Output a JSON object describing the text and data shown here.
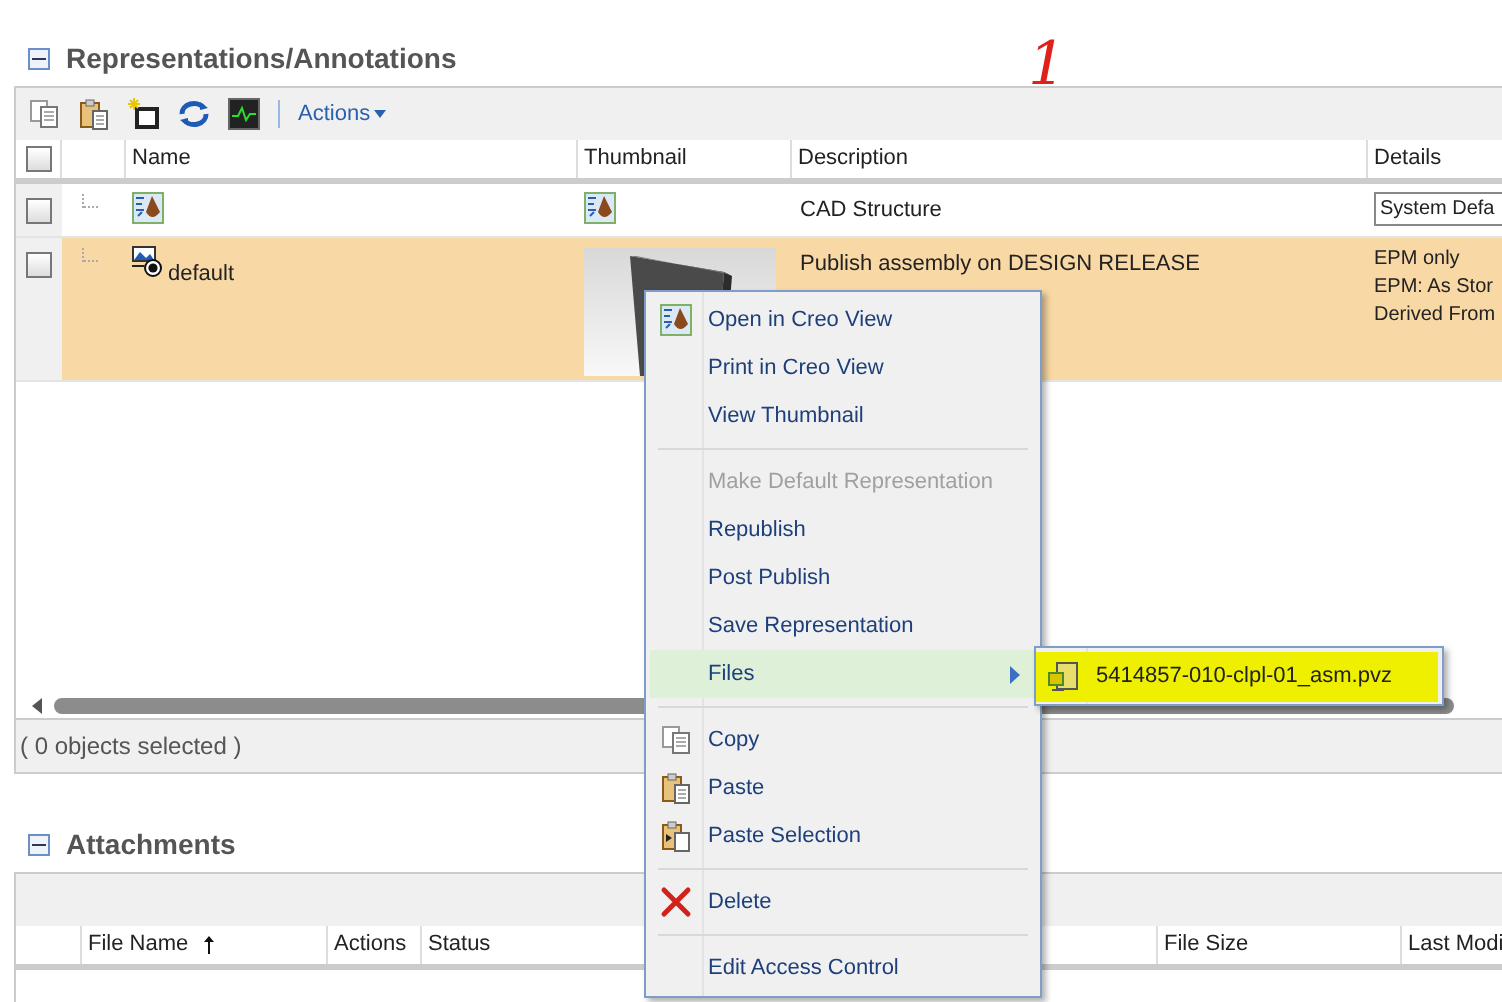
{
  "annotation_mark": "1",
  "representations": {
    "title": "Representations/Annotations",
    "expanded": true,
    "actions_label": "Actions",
    "all_checked": false,
    "columns": [
      "Name",
      "Thumbnail",
      "Description",
      "Details"
    ],
    "rows": [
      {
        "kind": "structure",
        "selected": false,
        "checked": false,
        "description": "CAD Structure",
        "details": [
          "System Defa"
        ]
      },
      {
        "kind": "representation",
        "selected": true,
        "checked": false,
        "name": "default",
        "description": "Publish assembly on DESIGN RELEASE",
        "details": [
          "EPM only",
          "EPM: As Stor",
          "Derived From"
        ]
      }
    ],
    "status": "( 0 objects selected )"
  },
  "attachments": {
    "title": "Attachments",
    "expanded": true,
    "columns": [
      {
        "label": "File Name",
        "sorted": true
      },
      {
        "label": "Actions"
      },
      {
        "label": "Status"
      },
      {
        "label": "File Size"
      },
      {
        "label": "Last Modi"
      }
    ]
  },
  "context_menu": {
    "items": [
      {
        "kind": "item",
        "label": "Open in Creo View",
        "disabled": false,
        "highlighted": false,
        "submenu": false
      },
      {
        "kind": "item",
        "label": "Print in Creo View",
        "disabled": false,
        "highlighted": false,
        "submenu": false
      },
      {
        "kind": "item",
        "label": "View Thumbnail",
        "disabled": false,
        "highlighted": false,
        "submenu": false
      },
      {
        "kind": "separator"
      },
      {
        "kind": "item",
        "label": "Make Default Representation",
        "disabled": true,
        "highlighted": false,
        "submenu": false
      },
      {
        "kind": "item",
        "label": "Republish",
        "disabled": false,
        "highlighted": false,
        "submenu": false
      },
      {
        "kind": "item",
        "label": "Post Publish",
        "disabled": false,
        "highlighted": false,
        "submenu": false
      },
      {
        "kind": "item",
        "label": "Save Representation",
        "disabled": false,
        "highlighted": false,
        "submenu": false
      },
      {
        "kind": "item",
        "label": "Files",
        "disabled": false,
        "highlighted": true,
        "submenu": true
      },
      {
        "kind": "separator"
      },
      {
        "kind": "item",
        "label": "Copy",
        "disabled": false,
        "highlighted": false,
        "submenu": false
      },
      {
        "kind": "item",
        "label": "Paste",
        "disabled": false,
        "highlighted": false,
        "submenu": false
      },
      {
        "kind": "item",
        "label": "Paste Selection",
        "disabled": false,
        "highlighted": false,
        "submenu": false
      },
      {
        "kind": "separator"
      },
      {
        "kind": "item",
        "label": "Delete",
        "disabled": false,
        "highlighted": false,
        "submenu": false
      },
      {
        "kind": "separator"
      },
      {
        "kind": "item",
        "label": "Edit Access Control",
        "disabled": false,
        "highlighted": false,
        "submenu": false
      }
    ]
  },
  "submenu": {
    "items": [
      {
        "label": "5414857-010-clpl-01_asm.pvz",
        "highlighted": true
      }
    ]
  }
}
